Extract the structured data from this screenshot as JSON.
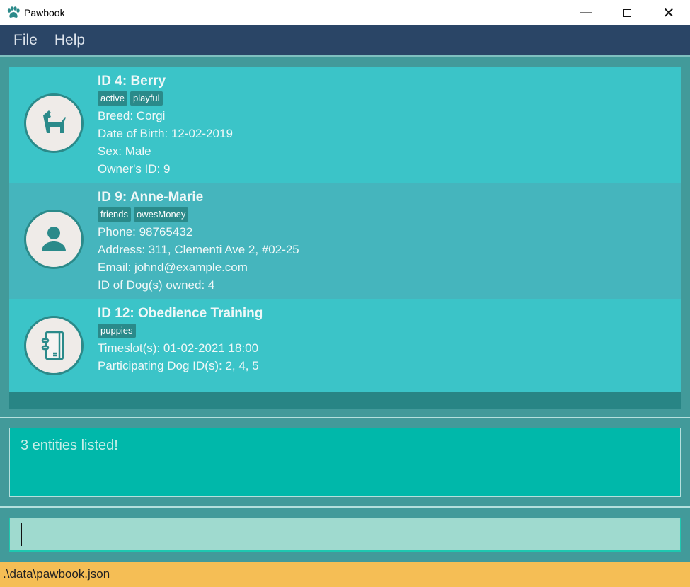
{
  "window": {
    "title": "Pawbook",
    "controls": [
      "minimize",
      "maximize",
      "close"
    ]
  },
  "menu": {
    "items": [
      "File",
      "Help"
    ]
  },
  "entities": [
    {
      "type": "dog",
      "icon": "dog-icon",
      "title": "ID 4:  Berry",
      "tags": [
        "active",
        "playful"
      ],
      "fields": [
        "Breed: Corgi",
        "Date of Birth: 12-02-2019",
        "Sex: Male",
        "Owner's ID: 9"
      ]
    },
    {
      "type": "owner",
      "icon": "person-icon",
      "title": "ID 9:  Anne-Marie",
      "tags": [
        "friends",
        "owesMoney"
      ],
      "fields": [
        "Phone: 98765432",
        "Address: 311, Clementi Ave 2, #02-25",
        "Email: johnd@example.com",
        "ID of Dog(s) owned: 4"
      ]
    },
    {
      "type": "program",
      "icon": "notebook-icon",
      "title": "ID 12:  Obedience Training",
      "tags": [
        "puppies"
      ],
      "fields": [
        "Timeslot(s): 01-02-2021 18:00",
        "Participating Dog ID(s): 2, 4, 5"
      ]
    }
  ],
  "result": {
    "text": "3 entities listed!"
  },
  "command": {
    "value": ""
  },
  "status": {
    "path": ".\\data\\pawbook.json"
  },
  "colors": {
    "menubar": "#2a4566",
    "card": "#3bc4c8",
    "card_alt": "#45b5bd",
    "tag": "#2a8a8a",
    "result": "#00b8aa",
    "command": "#9fdacf",
    "status": "#f5be55"
  }
}
